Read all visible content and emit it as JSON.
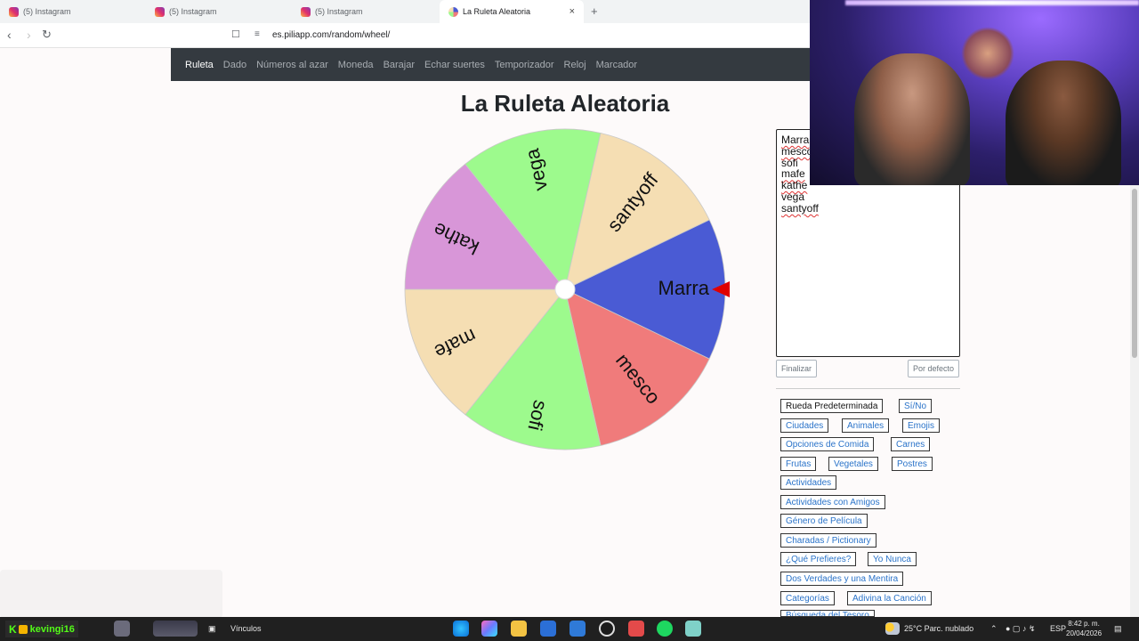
{
  "browser": {
    "tabs": [
      {
        "label": "(5) Instagram"
      },
      {
        "label": "(5) Instagram"
      },
      {
        "label": "(5) Instagram"
      },
      {
        "label": "La Ruleta Aleatoria"
      }
    ],
    "new_tab": "+",
    "close": "×",
    "url": "es.piliapp.com/random/wheel/"
  },
  "nav": {
    "items": [
      "Ruleta",
      "Dado",
      "Números al azar",
      "Moneda",
      "Barajar",
      "Echar suertes",
      "Temporizador",
      "Reloj",
      "Marcador"
    ]
  },
  "page": {
    "title": "La Ruleta Aleatoria"
  },
  "wheel": {
    "segments": [
      {
        "label": "Marra",
        "color": "#4a5bd4"
      },
      {
        "label": "mesco",
        "color": "#f07b7b"
      },
      {
        "label": "sofi",
        "color": "#9dfa8d"
      },
      {
        "label": "mafe",
        "color": "#f5deb3"
      },
      {
        "label": "kathe",
        "color": "#d896d8"
      },
      {
        "label": "vega",
        "color": "#9dfa8d"
      },
      {
        "label": "santyoff",
        "color": "#f5deb3"
      }
    ],
    "pointer_color": "#e00000"
  },
  "editor": {
    "lines": [
      "Marra",
      "mesco",
      "sofi",
      "mafe",
      "kathe",
      "vega",
      "santyoff"
    ],
    "finish_button": "Finalizar",
    "default_button": "Por defecto"
  },
  "presets": [
    {
      "label": "Rueda Predeterminada"
    },
    {
      "label": "Sí/No"
    },
    {
      "label": "Ciudades"
    },
    {
      "label": "Animales"
    },
    {
      "label": "Emojis"
    },
    {
      "label": "Opciones de Comida"
    },
    {
      "label": "Carnes"
    },
    {
      "label": "Frutas"
    },
    {
      "label": "Vegetales"
    },
    {
      "label": "Postres"
    },
    {
      "label": "Actividades"
    },
    {
      "label": "Actividades con Amigos"
    },
    {
      "label": "Género de Película"
    },
    {
      "label": "Charadas / Pictionary"
    },
    {
      "label": "¿Qué Prefieres?"
    },
    {
      "label": "Yo Nunca"
    },
    {
      "label": "Dos Verdades y una Mentira"
    },
    {
      "label": "Categorías"
    },
    {
      "label": "Adivina la Canción"
    },
    {
      "label": "Búsqueda del Tesoro"
    }
  ],
  "taskbar": {
    "kick_letter": "K",
    "username": "kevingi16",
    "links": "Vínculos",
    "weather": "25°C  Parc. nublado",
    "lang": "ESP",
    "time": "8:42 p. m.",
    "date": "20/04/2026"
  }
}
